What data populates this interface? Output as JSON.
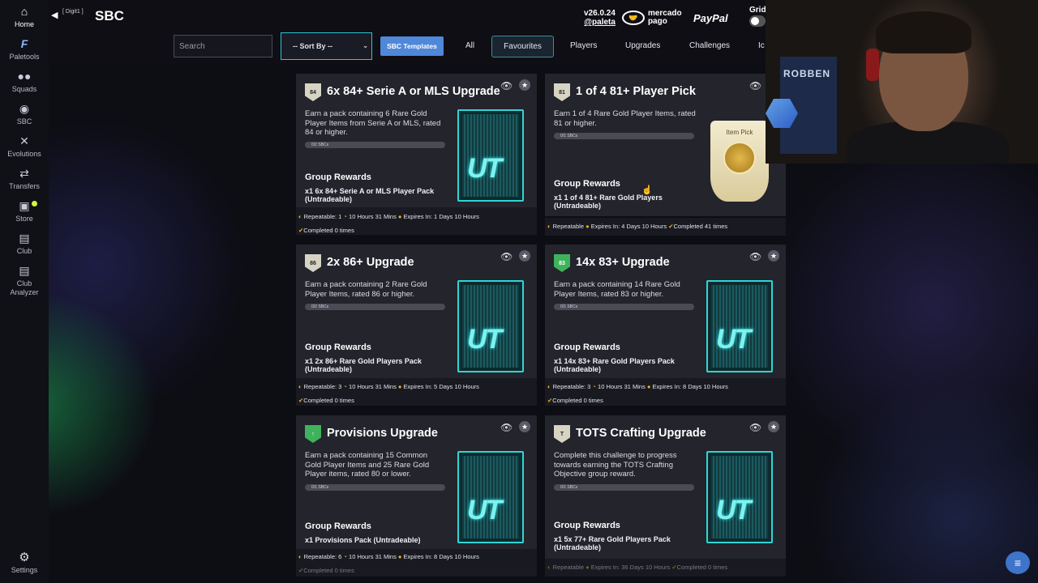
{
  "sidebar": {
    "items": [
      {
        "label": "Home",
        "icon": "home-icon",
        "glyph": "⌂"
      },
      {
        "label": "Paletools",
        "icon": "paletools-icon",
        "glyph": "⚡"
      },
      {
        "label": "Squads",
        "icon": "squads-icon",
        "glyph": "👥"
      },
      {
        "label": "SBC",
        "icon": "sbc-icon",
        "glyph": "◉"
      },
      {
        "label": "Evolutions",
        "icon": "evolutions-icon",
        "glyph": "✕"
      },
      {
        "label": "Transfers",
        "icon": "transfers-icon",
        "glyph": "⇄"
      },
      {
        "label": "Store",
        "icon": "store-icon",
        "glyph": "🛒"
      },
      {
        "label": "Club",
        "icon": "club-icon",
        "glyph": "▤"
      },
      {
        "label": "Club Analyzer",
        "icon": "club-analyzer-icon",
        "glyph": "▤"
      }
    ],
    "settings": "Settings"
  },
  "header": {
    "digit_label": "[ Digit1 ]",
    "title": "SBC",
    "version": "v26.0.24",
    "handle": "@paleta",
    "sponsor_mercado": "mercado pago",
    "sponsor_paypal": "PayPal",
    "grid_label": "Grid"
  },
  "filters": {
    "search_placeholder": "Search",
    "sort_label": "-- Sort By --",
    "templates_label": "SBC Templates",
    "tabs": [
      "All",
      "Favourites",
      "Players",
      "Upgrades",
      "Challenges",
      "Ic"
    ]
  },
  "colors": {
    "accent": "#27c7d9",
    "templates_button": "#4f87d9",
    "timer": "#f0b21b",
    "card_bg": "#23242c"
  },
  "cards": [
    {
      "title": "6x 84+ Serie A or MLS Upgrade",
      "desc": "Earn a pack containing 6 Rare Gold Player Items from Serie A or MLS, rated 84 or higher.",
      "progress": "0/2 SBCs",
      "group_label": "Group Rewards",
      "reward": "x1 6x 84+ Serie A or MLS Player Pack (Untradeable)",
      "repeatable": "Repeatable: 1",
      "refresh": "10 Hours 31 Mins",
      "expires": "Expires In: 1 Days 10 Hours",
      "completed": "Completed 0 times"
    },
    {
      "title": "1 of 4 81+ Player Pick",
      "desc": "Earn 1 of 4 Rare Gold Player Items, rated 81 or higher.",
      "progress": "0/1 SBCs",
      "group_label": "Group Rewards",
      "reward": "x1 1 of 4 81+ Rare Gold Players (Untradeable)",
      "repeatable": "Repeatable",
      "expires": "Expires In: 4 Days 10 Hours",
      "completed": "Completed 41 times",
      "item_pick_label": "Item Pick"
    },
    {
      "title": "2x 86+ Upgrade",
      "desc": "Earn a pack containing 2 Rare Gold Player Items, rated 86 or higher.",
      "progress": "0/2 SBCs",
      "group_label": "Group Rewards",
      "reward": "x1 2x 86+ Rare Gold Players Pack (Untradeable)",
      "repeatable": "Repeatable: 3",
      "refresh": "10 Hours 31 Mins",
      "expires": "Expires In: 5 Days 10 Hours",
      "completed": "Completed 0 times"
    },
    {
      "title": "14x 83+ Upgrade",
      "desc": "Earn a pack containing 14 Rare Gold Player Items, rated 83 or higher.",
      "progress": "0/1 SBCs",
      "group_label": "Group Rewards",
      "reward": "x1 14x 83+ Rare Gold Players Pack (Untradeable)",
      "repeatable": "Repeatable: 3",
      "refresh": "10 Hours 31 Mins",
      "expires": "Expires In: 8 Days 10 Hours",
      "completed": "Completed 0 times"
    },
    {
      "title": "Provisions Upgrade",
      "desc": "Earn a pack containing 15 Common Gold Player Items and 25 Rare Gold Player items, rated 80 or lower.",
      "progress": "0/1 SBCs",
      "group_label": "Group Rewards",
      "reward": "x1 Provisions Pack (Untradeable)",
      "repeatable": "Repeatable: 6",
      "refresh": "10 Hours 31 Mins",
      "expires": "Expires In: 8 Days 10 Hours",
      "completed": "Completed 0 times"
    },
    {
      "title": "TOTS Crafting Upgrade",
      "desc": "Complete this challenge to progress towards earning the TOTS Crafting Objective group reward.",
      "progress": "0/1 SBCs",
      "group_label": "Group Rewards",
      "reward": "x1 5x 77+ Rare Gold Players Pack (Untradeable)",
      "repeatable": "Repeatable",
      "expires": "Expires In: 36 Days 10 Hours",
      "completed": "Completed 0 times"
    }
  ],
  "webcam": {
    "jersey_text": "ROBBEN"
  },
  "pack_text": "UT",
  "fab_icon": "filter-lines-icon"
}
